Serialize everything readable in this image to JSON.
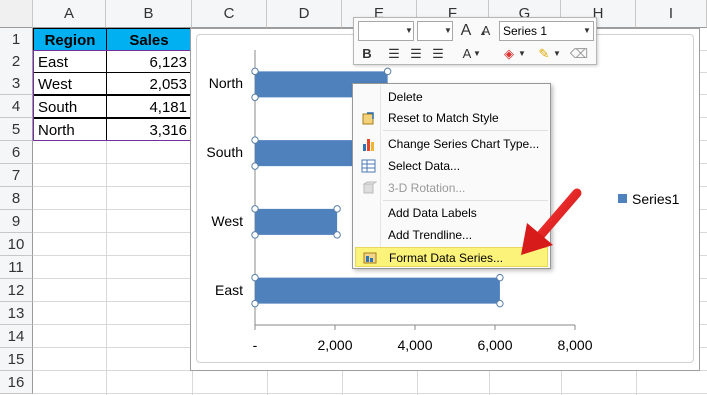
{
  "columns": [
    "A",
    "B",
    "C",
    "D",
    "E",
    "F",
    "G",
    "H",
    "I"
  ],
  "rows": [
    "1",
    "2",
    "3",
    "4",
    "5",
    "6",
    "7",
    "8",
    "9",
    "10",
    "11",
    "12",
    "13",
    "14",
    "15",
    "16"
  ],
  "table": {
    "headers": [
      "Region",
      "Sales"
    ],
    "rows": [
      {
        "region": "East",
        "sales": "6,123"
      },
      {
        "region": "West",
        "sales": "2,053"
      },
      {
        "region": "South",
        "sales": "4,181"
      },
      {
        "region": "North",
        "sales": "3,316"
      }
    ]
  },
  "chart_data": {
    "type": "bar",
    "orientation": "horizontal",
    "categories": [
      "East",
      "West",
      "South",
      "North"
    ],
    "series": [
      {
        "name": "Series1",
        "values": [
          6123,
          2053,
          4181,
          3316
        ]
      }
    ],
    "xticks": [
      "-",
      "2,000",
      "4,000",
      "6,000",
      "8,000"
    ],
    "xlim": [
      0,
      8000
    ],
    "legend": "right",
    "color": "#4f81bd",
    "grid": false
  },
  "mini_toolbar": {
    "font_name": "",
    "font_size": "",
    "grow_font": "A",
    "shrink_font": "A",
    "series_select": "Series 1",
    "bold": "B",
    "font_color": "A"
  },
  "context_menu": {
    "items": [
      {
        "label": "Delete",
        "disabled": false
      },
      {
        "label": "Reset to Match Style",
        "disabled": false
      },
      {
        "label": "Change Series Chart Type...",
        "disabled": false
      },
      {
        "label": "Select Data...",
        "disabled": false
      },
      {
        "label": "3-D Rotation...",
        "disabled": true
      },
      {
        "label": "Add Data Labels",
        "disabled": false
      },
      {
        "label": "Add Trendline...",
        "disabled": false
      },
      {
        "label": "Format Data Series...",
        "disabled": false,
        "highlighted": true
      }
    ]
  },
  "colors": {
    "header_fill": "#00b0f0",
    "bar": "#4f81bd",
    "highlight": "#fbf37a",
    "arrow": "#e31b1b"
  }
}
